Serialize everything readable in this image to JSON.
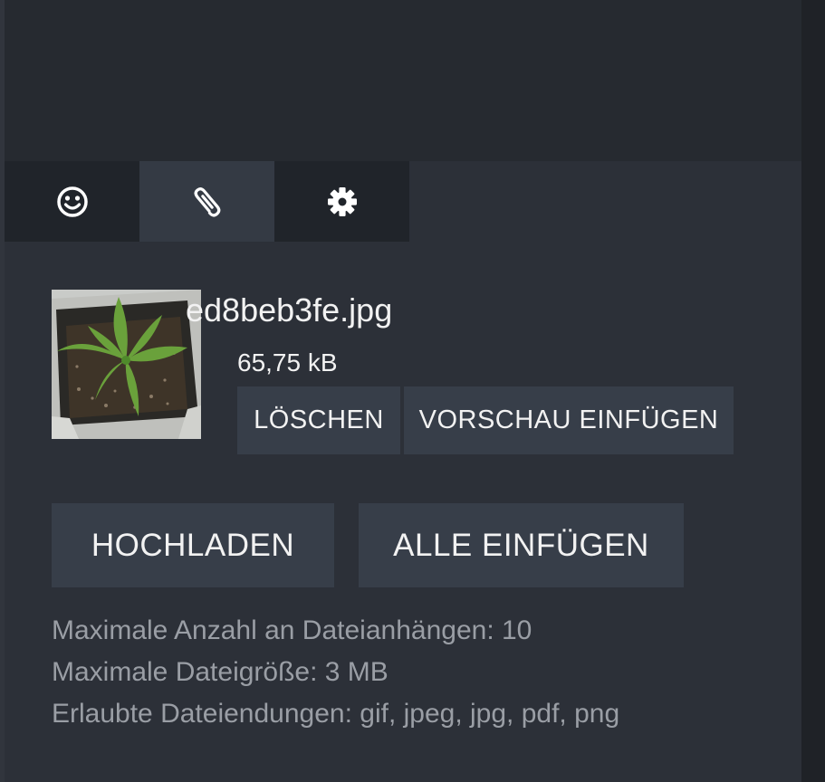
{
  "tabs": [
    {
      "icon": "smiley-icon",
      "active": false
    },
    {
      "icon": "paperclip-icon",
      "active": true
    },
    {
      "icon": "gear-icon",
      "active": false
    }
  ],
  "attachment": {
    "file_name": "ed8beb3fe.jpg",
    "file_size": "65,75 kB",
    "delete_label": "LÖSCHEN",
    "insert_preview_label": "VORSCHAU EINFÜGEN"
  },
  "actions": {
    "upload_label": "HOCHLADEN",
    "insert_all_label": "ALLE EINFÜGEN"
  },
  "limits": {
    "max_attachments": "Maximale Anzahl an Dateianhängen: 10",
    "max_file_size": "Maximale Dateigröße: 3 MB",
    "allowed_extensions": "Erlaubte Dateiendungen: gif, jpeg, jpg, pdf, png"
  },
  "colors": {
    "panel_bg": "#2c3038",
    "tab_bg": "#20242a",
    "tab_active_bg": "#343a44",
    "button_bg": "#373e49",
    "muted_text": "#9a9ea5"
  }
}
